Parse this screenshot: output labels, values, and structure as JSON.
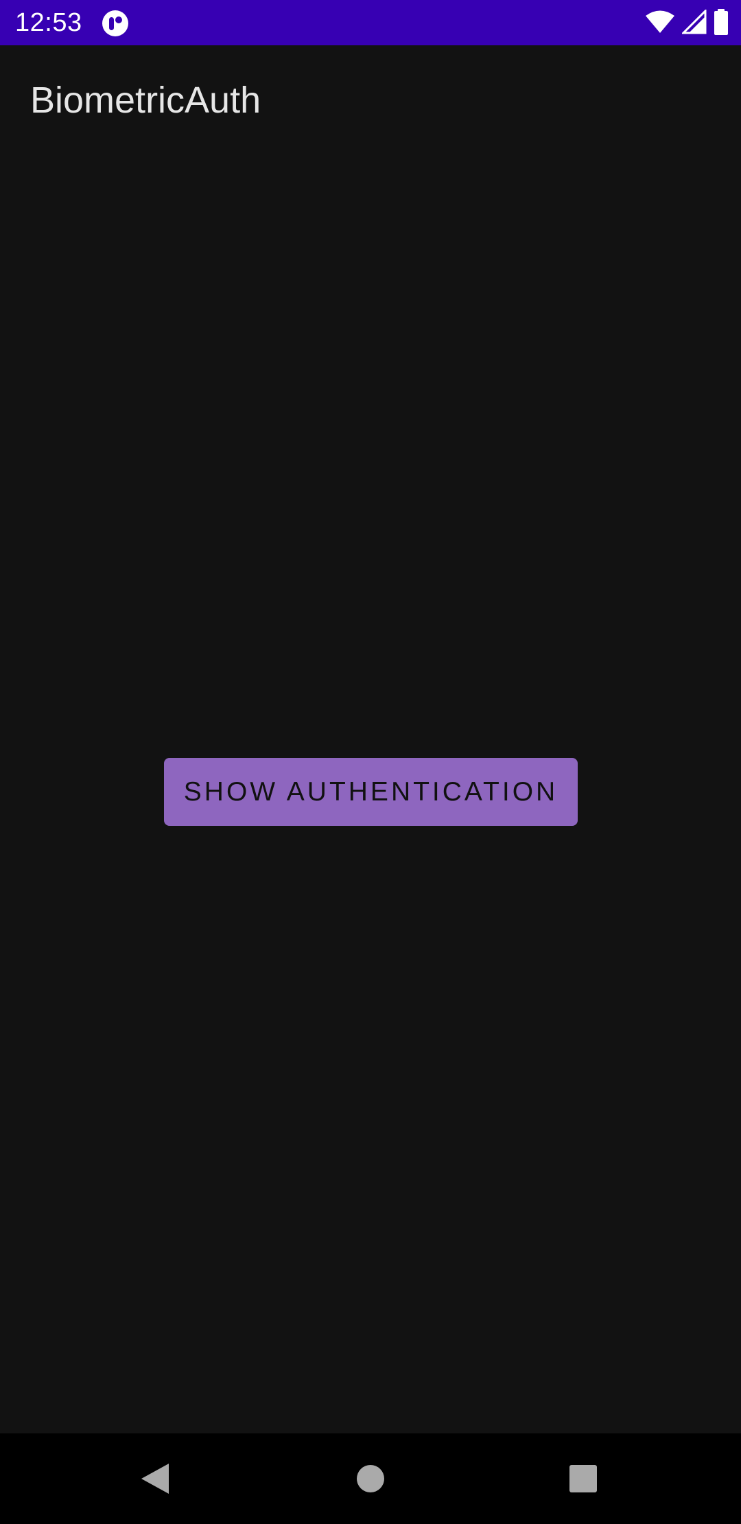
{
  "status_bar": {
    "time": "12:53",
    "app_icon": "app-notification-icon",
    "icons": [
      "wifi-icon",
      "cellular-signal-icon",
      "battery-icon"
    ],
    "background_color": "#3700b3"
  },
  "app_bar": {
    "title": "BiometricAuth"
  },
  "main": {
    "button_label": "SHOW AUTHENTICATION",
    "button_color": "#8e66bf",
    "background_color": "#121212"
  },
  "nav_bar": {
    "icons": [
      "back-icon",
      "home-icon",
      "recents-icon"
    ]
  }
}
